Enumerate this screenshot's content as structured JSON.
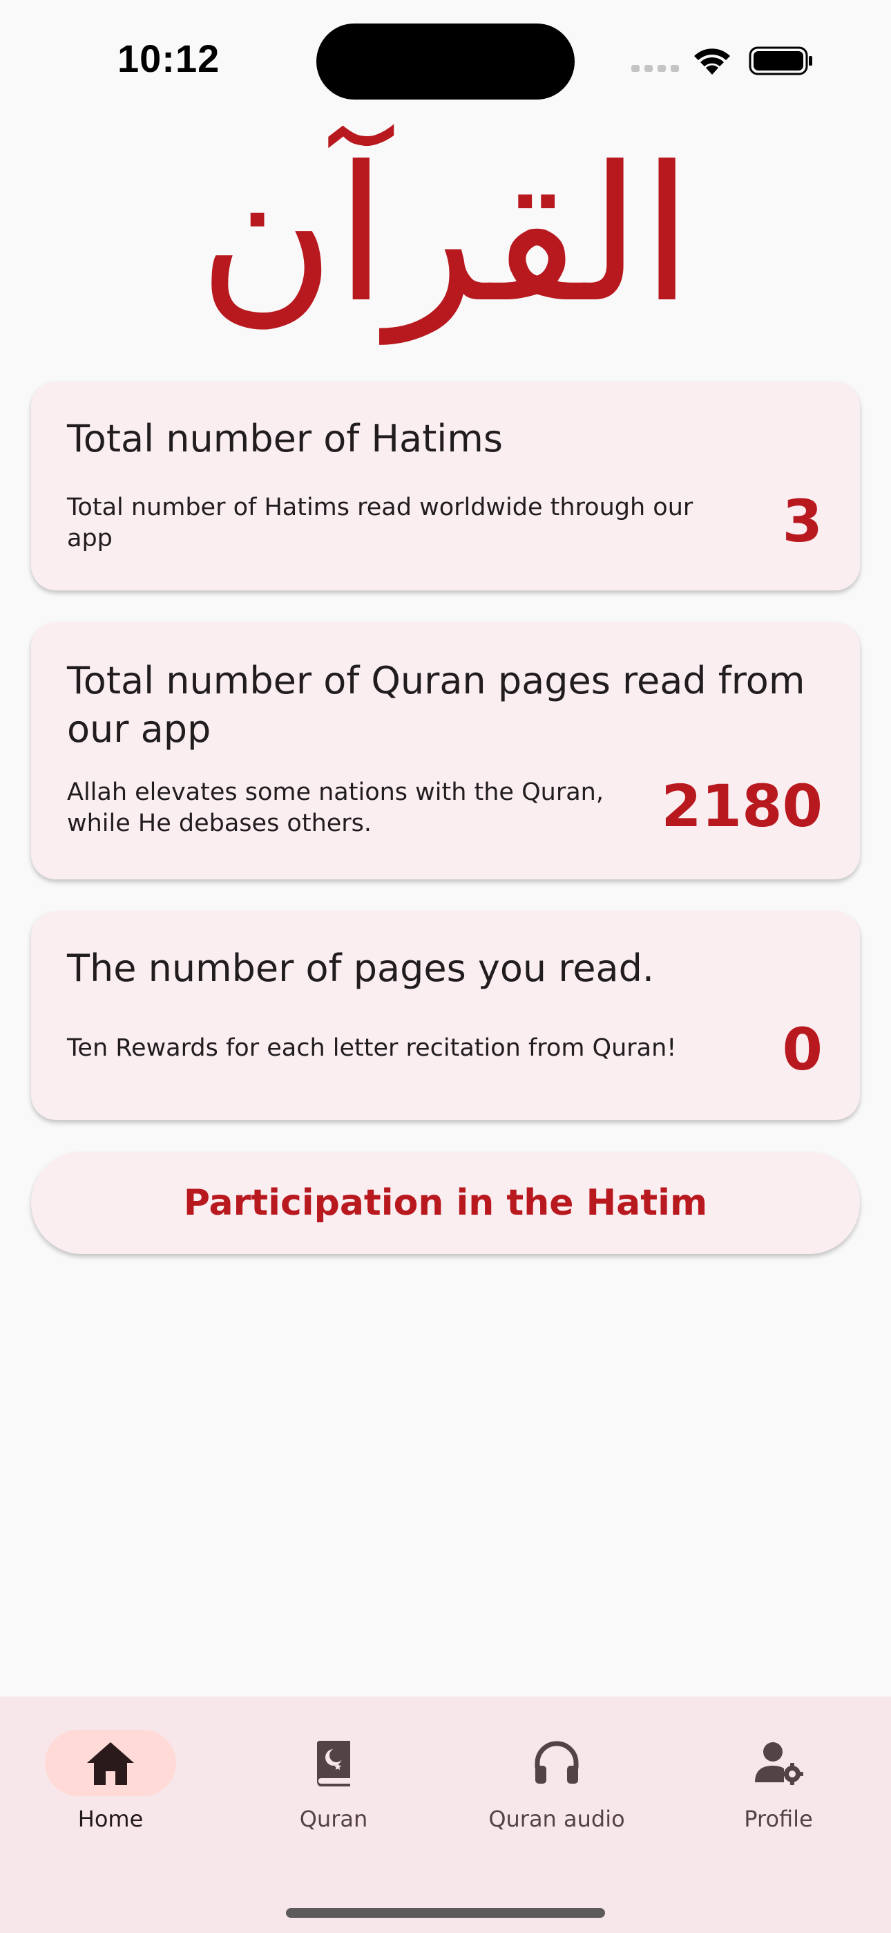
{
  "status_bar": {
    "time": "10:12"
  },
  "header": {
    "logo_text": "القرآن"
  },
  "cards": [
    {
      "title": "Total number of Hatims",
      "description": "Total number of Hatims read worldwide through our app",
      "value": "3"
    },
    {
      "title": "Total number of Quran pages read from our app",
      "description": "Allah elevates some nations with the Quran, while He debases others.",
      "value": "2180"
    },
    {
      "title": "The number of pages you read.",
      "description": "Ten Rewards for each letter recitation from Quran!",
      "value": "0"
    }
  ],
  "participate_button": {
    "label": "Participation in the Hatim"
  },
  "bottom_nav": {
    "items": [
      {
        "label": "Home",
        "icon": "home-icon",
        "active": true
      },
      {
        "label": "Quran",
        "icon": "quran-book-icon",
        "active": false
      },
      {
        "label": "Quran audio",
        "icon": "headphones-icon",
        "active": false
      },
      {
        "label": "Profile",
        "icon": "profile-settings-icon",
        "active": false
      }
    ]
  },
  "colors": {
    "accent": "#b8191f",
    "card_background": "#fbeef1",
    "nav_background": "#f8e7ea",
    "nav_active_pill": "#ffdad6"
  }
}
